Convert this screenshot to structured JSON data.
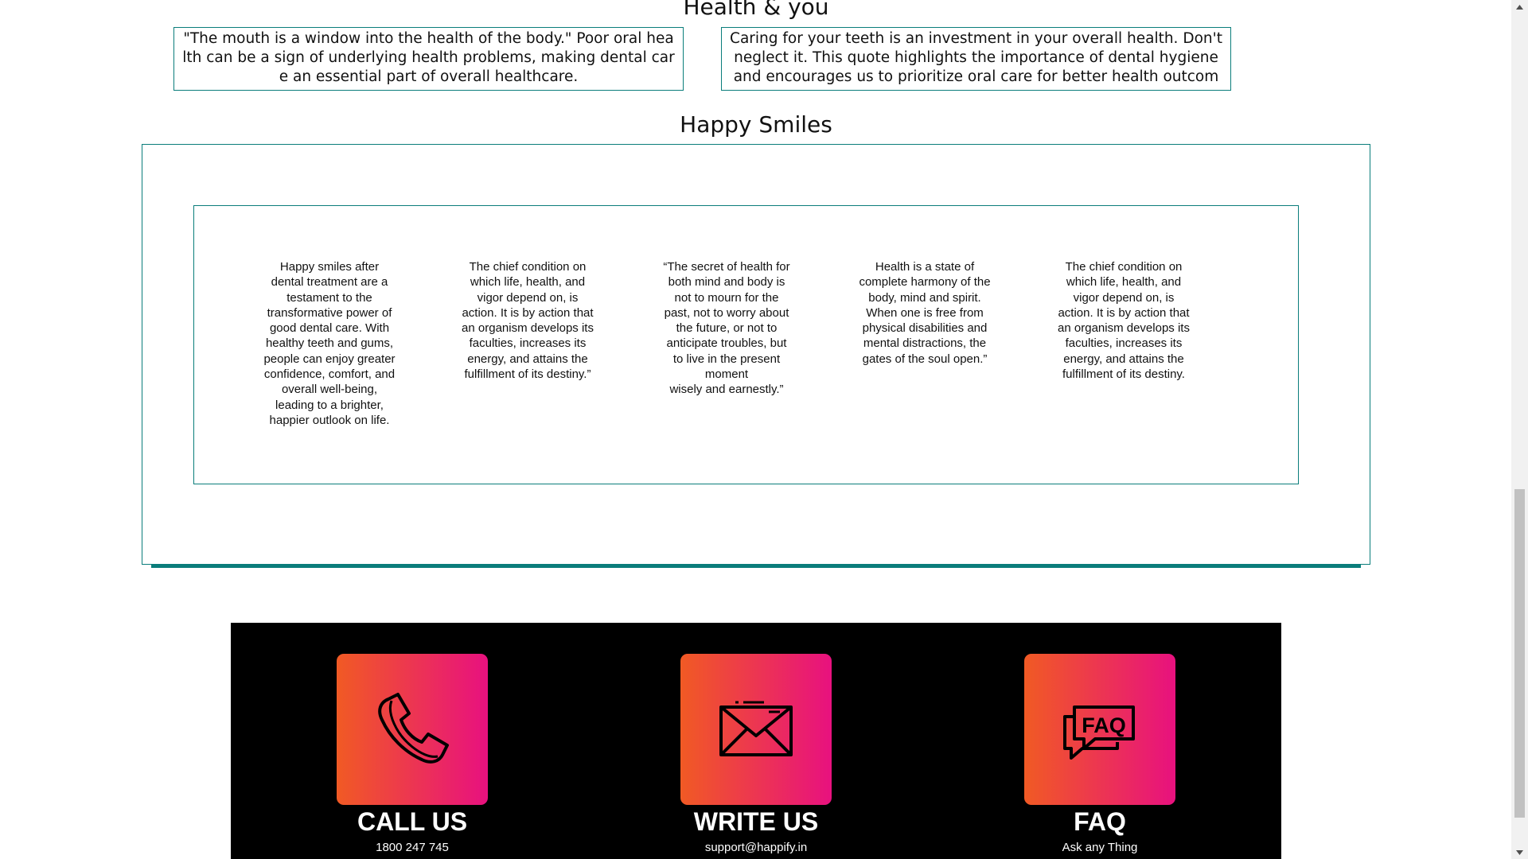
{
  "health_section": {
    "title": "Health & you",
    "quotes": [
      "\"The mouth is a window into the health of the body.\" Poor oral health can be a sign of underlying health problems, making dental care an essential part of overall healthcare.",
      "Caring for your teeth is an investment in your overall health. Don't neglect it. This quote highlights the importance of dental hygiene and encourages us to prioritize oral care for better health outcomes."
    ]
  },
  "smiles_section": {
    "title": "Happy Smiles",
    "slides": [
      "Happy smiles after\ndental treatment are a\ntestament to the\ntransformative power of\ngood dental care. With\nhealthy teeth and gums,\npeople can enjoy greater\nconfidence, comfort, and\noverall well-being,\nleading to a brighter,\nhappier outlook on life.",
      "The chief condition on\nwhich life, health, and\nvigor depend on, is\naction. It is by action that\nan organism develops its\nfaculties, increases its\nenergy, and attains the\nfulfillment of its destiny.”",
      "“The secret of health for\nboth mind and body is\nnot to mourn for the\npast, not to worry about\nthe future, or not to\nanticipate troubles, but\nto live in the present\nmoment\nwisely and earnestly.”",
      "Health is a state of\ncomplete harmony of the\nbody, mind and spirit.\nWhen one is free from\nphysical disabilities and\nmental distractions, the\ngates of the soul open.”",
      "The chief condition on\nwhich life, health, and\nvigor depend on, is\naction. It is by action that\nan organism develops its\nfaculties, increases its\nenergy, and attains the\nfulfillment of its destiny."
    ]
  },
  "contact": {
    "call": {
      "heading": "CALL US",
      "detail": "1800 247 745",
      "icon": "phone-icon"
    },
    "write": {
      "heading": "WRITE US",
      "detail": "support@happify.in",
      "icon": "mail-icon"
    },
    "faq": {
      "heading": "FAQ",
      "detail": "Ask any Thing",
      "icon": "faq-icon",
      "icon_text": "FAQ"
    },
    "gradient_start": "#f15a24",
    "gradient_end": "#e8117f"
  },
  "colors": {
    "accent": "#0a7d7b",
    "band": "#000000"
  }
}
